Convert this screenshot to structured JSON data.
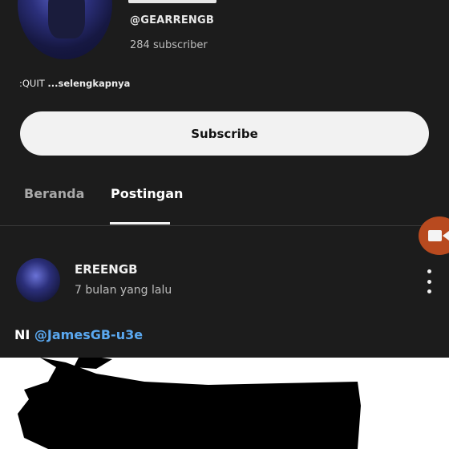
{
  "channel": {
    "handle": "@GEARRENGB",
    "subscribers": "284 subscriber",
    "description": ":QUIT",
    "description_more": "...selengkapnya",
    "subscribe_label": "Subscribe"
  },
  "tabs": [
    {
      "label": "Beranda",
      "active": false
    },
    {
      "label": "Postingan",
      "active": true
    }
  ],
  "post": {
    "author": "EREENGB",
    "time": "7 bulan yang lalu",
    "text_prefix": "NI",
    "mention": "@JamesGB-u3e"
  },
  "icons": {
    "fab": "video-camera-icon",
    "menu": "more-vertical-icon"
  },
  "colors": {
    "background": "#1c1c1c",
    "mention": "#5aa8f0",
    "fab": "#b84a1f"
  }
}
